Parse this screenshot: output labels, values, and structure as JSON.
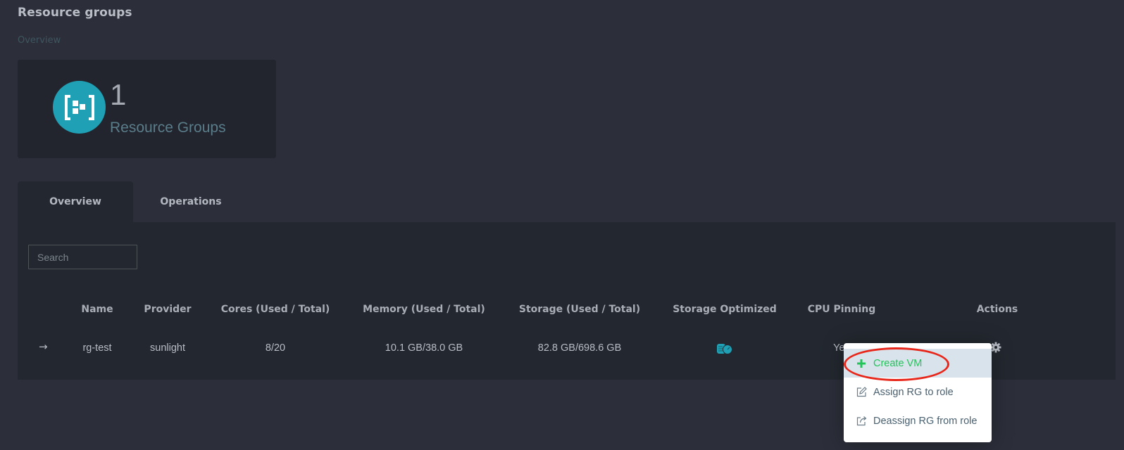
{
  "header": {
    "title": "Resource groups",
    "breadcrumb": "Overview"
  },
  "stat_card": {
    "icon": "resource-group-icon",
    "value": "1",
    "label": "Resource Groups"
  },
  "tabs": [
    {
      "label": "Overview",
      "active": true
    },
    {
      "label": "Operations",
      "active": false
    }
  ],
  "search": {
    "placeholder": "Search",
    "value": ""
  },
  "table": {
    "columns": [
      "Name",
      "Provider",
      "Cores (Used / Total)",
      "Memory (Used / Total)",
      "Storage (Used / Total)",
      "Storage Optimized",
      "CPU Pinning",
      "Actions"
    ],
    "rows": [
      {
        "expand_icon": "arrow-right-icon",
        "name": "rg-test",
        "provider": "sunlight",
        "cores": "8/20",
        "memory": "10.1 GB/38.0 GB",
        "storage": "82.8 GB/698.6 GB",
        "storage_optimized_icon": "storage-optimized-icon",
        "cpu_pinning": "Yes",
        "actions_icon": "gear-icon"
      }
    ]
  },
  "actions_menu": {
    "items": [
      {
        "label": "Create VM",
        "icon": "plus-icon",
        "highlighted": true
      },
      {
        "label": "Assign RG to role",
        "icon": "edit-icon"
      },
      {
        "label": "Deassign RG from role",
        "icon": "external-link-icon"
      }
    ]
  },
  "colors": {
    "accent": "#1fa0b4",
    "create_green": "#24c45a",
    "annotation_red": "#e8271a",
    "background": "#2c2f3a",
    "panel": "#232830"
  }
}
